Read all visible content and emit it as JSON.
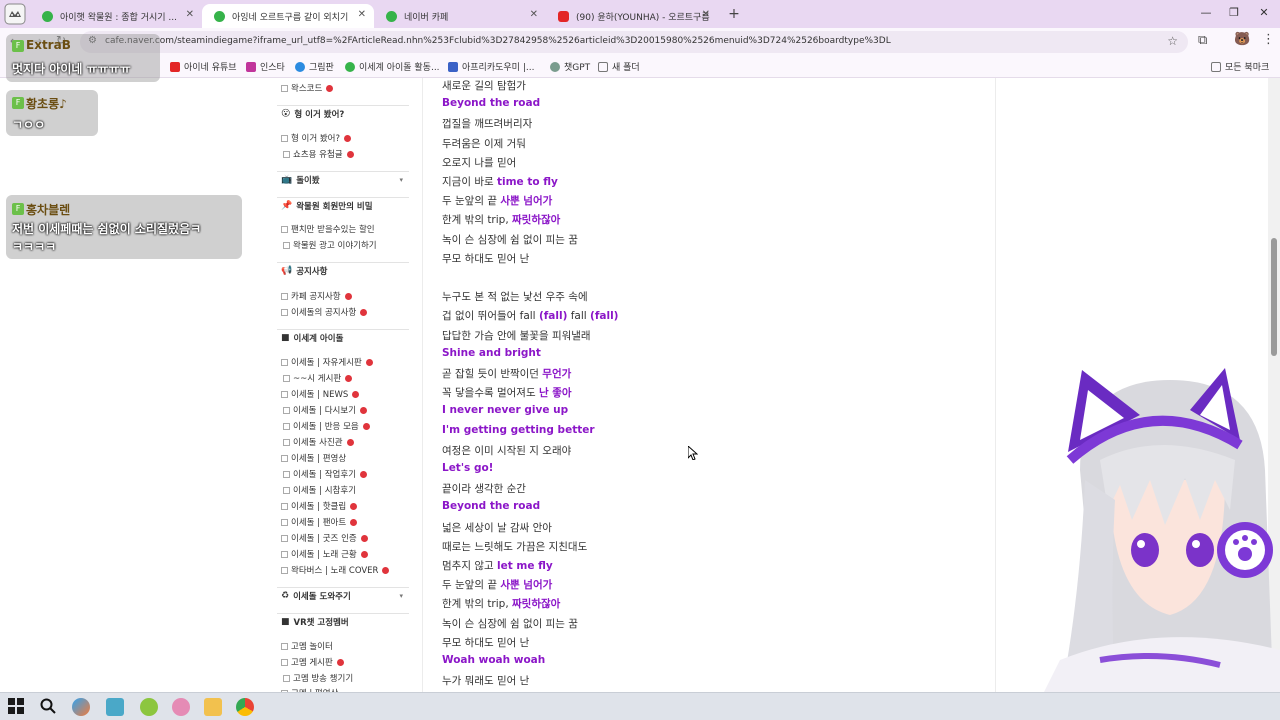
{
  "browser": {
    "tabs": [
      {
        "title": "아이햇 왁물원 : 종합 거시기 ...",
        "color": "#36b34a"
      },
      {
        "title": "아잉네 오르트구름 같이 외치기",
        "color": "#36b34a"
      },
      {
        "title": "네이버 카페",
        "color": "#36b34a"
      },
      {
        "title": "(90) 윤하(YOUNHA) - 오르트구름",
        "color": "#e32626"
      }
    ],
    "url": "cafe.naver.com/steamindiegame?iframe_url_utf8=%2FArticleRead.nhn%253Fclubid%3D27842958%2526articleid%3D20015980%2526menuid%3D724%2526boardtype%3DL",
    "bookmarks": [
      {
        "label": "아이네 유튜브",
        "color": "#e32626"
      },
      {
        "label": "인스타",
        "color": "#c1359b"
      },
      {
        "label": "그림판",
        "color": "#2b8be0"
      },
      {
        "label": "이세계 아이돌 활동...",
        "color": "#36b34a"
      },
      {
        "label": "아프리카도우미 |...",
        "color": "#3b62c6"
      },
      {
        "label": "챗GPT",
        "color": "#7a9c8e"
      },
      {
        "label": "새 폴더",
        "color": "#999999"
      }
    ],
    "all_bookmarks": "모든 북마크"
  },
  "sidebar": {
    "items": [
      {
        "label": "왁스코드",
        "type": "item"
      },
      {
        "label": "형 이거 봤어?",
        "type": "header"
      },
      {
        "label": "형 이거 봤어?",
        "type": "item"
      },
      {
        "label": "쇼츠용 유첨글",
        "type": "subitem"
      },
      {
        "label": "돌이봤",
        "type": "header"
      },
      {
        "label": "왁물원 회원만의 비밀",
        "type": "header"
      },
      {
        "label": "팬치만 받을수있는 할인",
        "type": "item"
      },
      {
        "label": "왁물원 광고 이야기하기",
        "type": "subitem"
      },
      {
        "label": "공지사항",
        "type": "header"
      },
      {
        "label": "카페 공지사항",
        "type": "item"
      },
      {
        "label": "이세돌의 공지사항",
        "type": "item"
      },
      {
        "label": "이세계 아이돌",
        "type": "header"
      },
      {
        "label": "이세돌 | 자유게시판",
        "type": "item"
      },
      {
        "label": "~~시 게시판",
        "type": "subitem"
      },
      {
        "label": "이세돌 | NEWS",
        "type": "item"
      },
      {
        "label": "이세돌 | 다시보기",
        "type": "subitem"
      },
      {
        "label": "이세돌 | 반응 모음",
        "type": "subitem"
      },
      {
        "label": "이세돌 사진관",
        "type": "subitem"
      },
      {
        "label": "이세돌 | 편영상",
        "type": "item"
      },
      {
        "label": "이세돌 | 작업후기",
        "type": "subitem"
      },
      {
        "label": "이세돌 | 시참후기",
        "type": "subitem"
      },
      {
        "label": "이세돌 | 핫클립",
        "type": "item"
      },
      {
        "label": "이세돌 | 팬아트",
        "type": "item"
      },
      {
        "label": "이세돌 | 굿즈 인증",
        "type": "item"
      },
      {
        "label": "이세돌 | 노래 근황",
        "type": "item"
      },
      {
        "label": "왁타버스 | 노래 COVER",
        "type": "item"
      },
      {
        "label": "이세돌 도와주기",
        "type": "header"
      },
      {
        "label": "VR챗 고정멤버",
        "type": "header"
      },
      {
        "label": "고멤 놀이터",
        "type": "item"
      },
      {
        "label": "고멤 게시판",
        "type": "item"
      },
      {
        "label": "고멤 방송 챙기기",
        "type": "subitem"
      },
      {
        "label": "고멤 | 편영상",
        "type": "item"
      }
    ]
  },
  "lyrics": [
    [
      {
        "t": "새로운 길의 탐험가"
      }
    ],
    [
      {
        "t": "Beyond the road",
        "h": true
      }
    ],
    [
      {
        "t": "껍질을 깨뜨려버리자"
      }
    ],
    [
      {
        "t": "두려움은 이제 거둬"
      }
    ],
    [
      {
        "t": "오로지 나를 믿어"
      }
    ],
    [
      {
        "t": "지금이 바로 "
      },
      {
        "t": "time to fly",
        "h": true
      }
    ],
    [
      {
        "t": "두 눈앞의 끝 "
      },
      {
        "t": "사뿐 넘어가",
        "h": true
      }
    ],
    [
      {
        "t": "한계 밖의 trip, "
      },
      {
        "t": "짜릿하잖아",
        "h": true
      }
    ],
    [
      {
        "t": "녹이 슨 심장에 쉼 없이 피는 꿈"
      }
    ],
    [
      {
        "t": "무모 하대도 믿어 난"
      }
    ],
    [],
    [
      {
        "t": "누구도 본 적 없는 낯선 우주 속에"
      }
    ],
    [
      {
        "t": "겁 없이 뛰어들어 fall "
      },
      {
        "t": "(fall)",
        "h": true
      },
      {
        "t": " fall "
      },
      {
        "t": "(fall)",
        "h": true
      }
    ],
    [
      {
        "t": "답답한 가슴 안에 불꽃을 피워낼래"
      }
    ],
    [
      {
        "t": "Shine and bright",
        "h": true
      }
    ],
    [
      {
        "t": "곧 잡힐 듯이 반짝이던 "
      },
      {
        "t": "무언가",
        "h": true
      }
    ],
    [
      {
        "t": "꼭 닿을수록 멀어져도 "
      },
      {
        "t": "난 좋아",
        "h": true
      }
    ],
    [
      {
        "t": "I never never give up",
        "h": true
      }
    ],
    [
      {
        "t": "I'm getting getting better",
        "h": true
      }
    ],
    [
      {
        "t": "여정은 이미 시작된 지 오래야"
      }
    ],
    [
      {
        "t": "Let's go!",
        "h": true
      }
    ],
    [
      {
        "t": "끝이라 생각한 순간"
      }
    ],
    [
      {
        "t": "Beyond the road",
        "h": true
      }
    ],
    [
      {
        "t": "넓은 세상이 날 감싸 안아"
      }
    ],
    [
      {
        "t": "때로는 느릿해도 가끔은 지친대도"
      }
    ],
    [
      {
        "t": "멈추지 않고 "
      },
      {
        "t": "let me fly",
        "h": true
      }
    ],
    [
      {
        "t": "두 눈앞의 끝 "
      },
      {
        "t": "사뿐 넘어가",
        "h": true
      }
    ],
    [
      {
        "t": "한계 밖의 trip, "
      },
      {
        "t": "짜릿하잖아",
        "h": true
      }
    ],
    [
      {
        "t": "녹이 슨 심장에 쉼 없이 피는 꿈"
      }
    ],
    [
      {
        "t": "무모 하대도 믿어 난"
      }
    ],
    [
      {
        "t": "Woah woah woah",
        "h": true
      }
    ],
    [
      {
        "t": "누가 뭐래도 믿어 난"
      }
    ]
  ],
  "chat": [
    {
      "name": "ExtraB",
      "message": "멋지다 아이네 ㅠㅠㅠㅠ"
    },
    {
      "name": "황초롱♪",
      "message": "ㄱㅇㅇ"
    },
    {
      "name": "홍차블렌",
      "message": "저번 이세페때는 쉼없이 소리질렀음ㅋ",
      "message2": "ㅋㅋㅋㅋ"
    }
  ],
  "colors": {
    "accent": "#8b16c8",
    "tabbar": "#e9d8f2"
  }
}
